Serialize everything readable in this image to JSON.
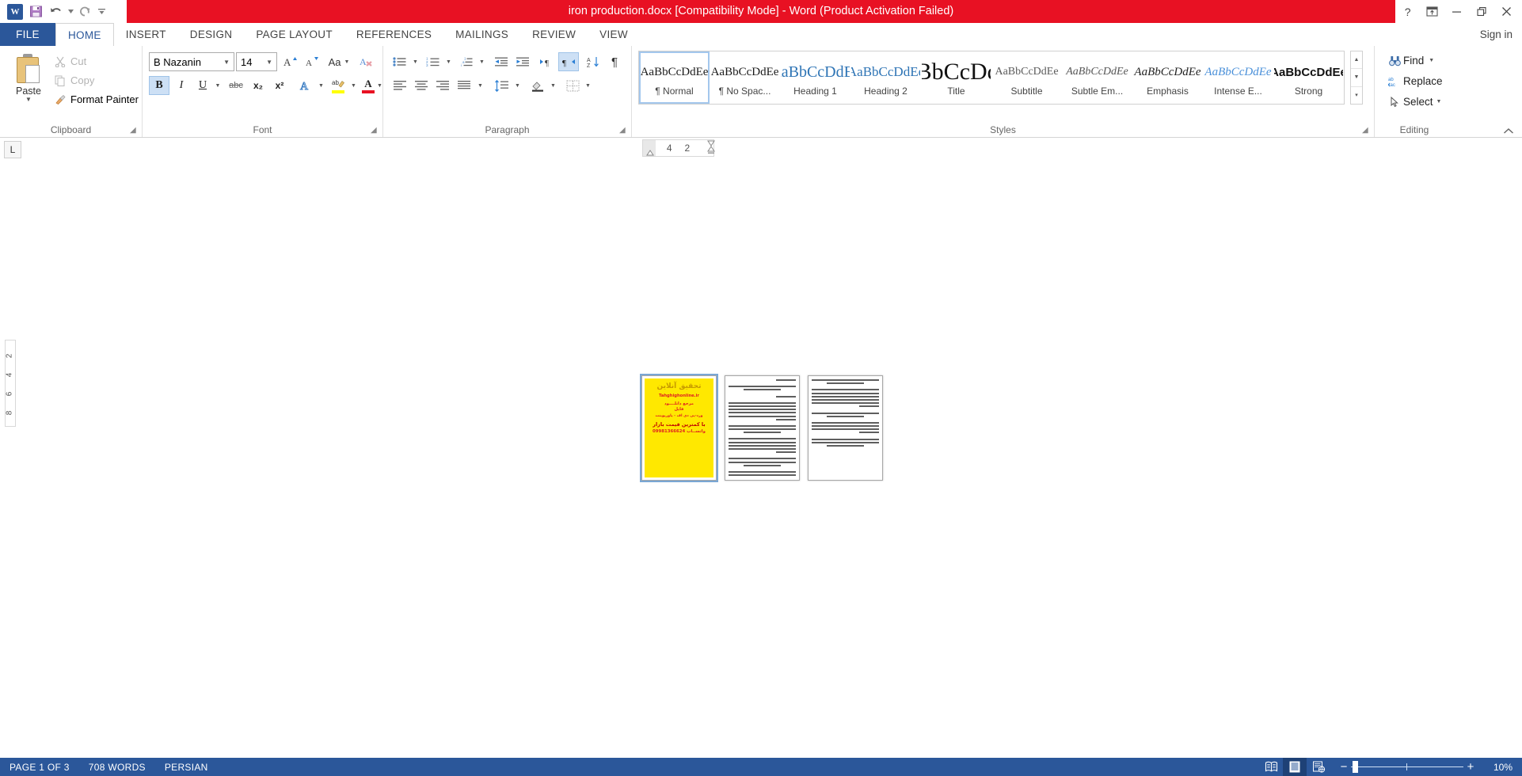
{
  "titlebar": {
    "document_title": "iron production.docx [Compatibility Mode]  -  Word (Product Activation Failed)",
    "quick_access": [
      {
        "name": "word-logo-icon",
        "label": "W"
      },
      {
        "name": "save-icon",
        "label": "Save"
      },
      {
        "name": "undo-icon",
        "label": "Undo"
      },
      {
        "name": "redo-icon",
        "label": "Redo"
      },
      {
        "name": "customize-qat-icon",
        "label": "Customize Quick Access Toolbar"
      }
    ],
    "window_controls": [
      {
        "name": "help-button",
        "glyph": "?"
      },
      {
        "name": "ribbon-display-options-button",
        "glyph": "⤒"
      },
      {
        "name": "minimize-button",
        "glyph": "–"
      },
      {
        "name": "restore-button",
        "glyph": "❐"
      },
      {
        "name": "close-button",
        "glyph": "✕"
      }
    ]
  },
  "tabs": {
    "items": [
      {
        "label": "FILE",
        "key": "file"
      },
      {
        "label": "HOME",
        "key": "home"
      },
      {
        "label": "INSERT",
        "key": "insert"
      },
      {
        "label": "DESIGN",
        "key": "design"
      },
      {
        "label": "PAGE LAYOUT",
        "key": "page-layout"
      },
      {
        "label": "REFERENCES",
        "key": "references"
      },
      {
        "label": "MAILINGS",
        "key": "mailings"
      },
      {
        "label": "REVIEW",
        "key": "review"
      },
      {
        "label": "VIEW",
        "key": "view"
      }
    ],
    "active": "HOME",
    "sign_in": "Sign in"
  },
  "ribbon": {
    "clipboard": {
      "label": "Clipboard",
      "paste": "Paste",
      "cut": "Cut",
      "copy": "Copy",
      "format_painter": "Format Painter"
    },
    "font": {
      "label": "Font",
      "font_name": "B Nazanin",
      "font_name_placeholder": "Font",
      "font_size": "14",
      "font_size_placeholder": "Size",
      "buttons": [
        {
          "name": "grow-font-button",
          "tip": "Grow Font"
        },
        {
          "name": "shrink-font-button",
          "tip": "Shrink Font"
        },
        {
          "name": "change-case-button",
          "tip": "Change Case",
          "label": "Aa"
        },
        {
          "name": "clear-formatting-button",
          "tip": "Clear All Formatting"
        },
        {
          "name": "bold-button",
          "label": "B",
          "active": true
        },
        {
          "name": "italic-button",
          "label": "I"
        },
        {
          "name": "underline-button",
          "label": "U"
        },
        {
          "name": "strikethrough-button",
          "label": "abc"
        },
        {
          "name": "subscript-button",
          "label": "x₂"
        },
        {
          "name": "superscript-button",
          "label": "x²"
        },
        {
          "name": "text-effects-button",
          "label": "A"
        },
        {
          "name": "text-highlight-color-button",
          "label": "ab"
        },
        {
          "name": "font-color-button",
          "label": "A"
        }
      ]
    },
    "paragraph": {
      "label": "Paragraph",
      "buttons": [
        {
          "name": "bullets-button",
          "tip": "Bullets"
        },
        {
          "name": "numbering-button",
          "tip": "Numbering"
        },
        {
          "name": "multilevel-list-button",
          "tip": "Multilevel List"
        },
        {
          "name": "decrease-indent-button",
          "tip": "Decrease Indent"
        },
        {
          "name": "increase-indent-button",
          "tip": "Increase Indent"
        },
        {
          "name": "ltr-text-direction-button",
          "tip": "Left-to-Right Text Direction"
        },
        {
          "name": "rtl-text-direction-button",
          "tip": "Right-to-Left Text Direction",
          "active": true
        },
        {
          "name": "sort-button",
          "tip": "Sort"
        },
        {
          "name": "show-formatting-marks-button",
          "tip": "Show/Hide ¶"
        },
        {
          "name": "align-left-button",
          "tip": "Align Left"
        },
        {
          "name": "align-center-button",
          "tip": "Center"
        },
        {
          "name": "align-right-button",
          "tip": "Align Right"
        },
        {
          "name": "justify-button",
          "tip": "Justify"
        },
        {
          "name": "line-spacing-button",
          "tip": "Line and Paragraph Spacing"
        },
        {
          "name": "shading-button",
          "tip": "Shading"
        },
        {
          "name": "borders-button",
          "tip": "Borders"
        }
      ]
    },
    "styles": {
      "label": "Styles",
      "items": [
        {
          "preview": "AaBbCcDdEe",
          "name": "¶ Normal",
          "selected": true,
          "kind": "normal"
        },
        {
          "preview": "AaBbCcDdEe",
          "name": "¶ No Spac...",
          "kind": "normal"
        },
        {
          "preview": "AaBbCcDdEe",
          "name": "Heading 1",
          "kind": "heading1"
        },
        {
          "preview": "AaBbCcDdEe",
          "name": "Heading 2",
          "kind": "heading2"
        },
        {
          "preview": "AaBbCcDdEe",
          "name": "Title",
          "kind": "title"
        },
        {
          "preview": "AaBbCcDdEe",
          "name": "Subtitle",
          "kind": "subtitle"
        },
        {
          "preview": "AaBbCcDdEe",
          "name": "Subtle Em...",
          "kind": "subtle-em"
        },
        {
          "preview": "AaBbCcDdEe",
          "name": "Emphasis",
          "kind": "emphasis"
        },
        {
          "preview": "AaBbCcDdEe",
          "name": "Intense E...",
          "kind": "intense-em"
        },
        {
          "preview": "AaBbCcDdEe",
          "name": "Strong",
          "kind": "strong"
        }
      ]
    },
    "editing": {
      "label": "Editing",
      "find": "Find",
      "replace": "Replace",
      "select": "Select"
    }
  },
  "ruler": {
    "tab_stop_marker": "L",
    "numbers": [
      "4",
      "2"
    ],
    "vertical_numbers": [
      "2",
      "4",
      "6",
      "8"
    ]
  },
  "document": {
    "pages": [
      {
        "index": 1,
        "type": "cover",
        "selected": true,
        "background_color": "#ffe800",
        "lines": [
          {
            "text": "تحقیق آنلاین",
            "color": "#c79a00",
            "size": 9,
            "bold": true
          },
          {
            "text": "Tahghighonline.ir",
            "color": "#e02020",
            "size": 5,
            "bold": true
          },
          {
            "text": "مرجع دانلــــود",
            "color": "#e02020",
            "size": 5,
            "bold": true
          },
          {
            "text": "فایل",
            "color": "#e02020",
            "size": 5,
            "bold": true
          },
          {
            "text": "ورد-پی دی اف - پاورپوینت",
            "color": "#e02020",
            "size": 4.5,
            "bold": true
          },
          {
            "text": "با کمترین قیمت بازار",
            "color": "#c00000",
            "size": 6.5,
            "bold": true
          },
          {
            "text": "09981366624 واتســاب",
            "color": "#e02020",
            "size": 5.5,
            "bold": true
          }
        ]
      },
      {
        "index": 2,
        "type": "text",
        "selected": false
      },
      {
        "index": 3,
        "type": "text",
        "selected": false
      }
    ]
  },
  "statusbar": {
    "page_info": "PAGE 1 OF 3",
    "word_count": "708 WORDS",
    "language": "PERSIAN",
    "views": [
      {
        "name": "read-mode-button",
        "label": "Read Mode",
        "active": false
      },
      {
        "name": "print-layout-button",
        "label": "Print Layout",
        "active": true
      },
      {
        "name": "web-layout-button",
        "label": "Web Layout",
        "active": false
      }
    ],
    "zoom_out_label": "−",
    "zoom_in_label": "+",
    "zoom_level": "10%"
  },
  "colors": {
    "titlebar_red": "#e81123",
    "word_blue": "#2b579a",
    "accent_blue": "#cde0f5",
    "highlight_yellow": "#ffe800",
    "red_text": "#e02020"
  }
}
